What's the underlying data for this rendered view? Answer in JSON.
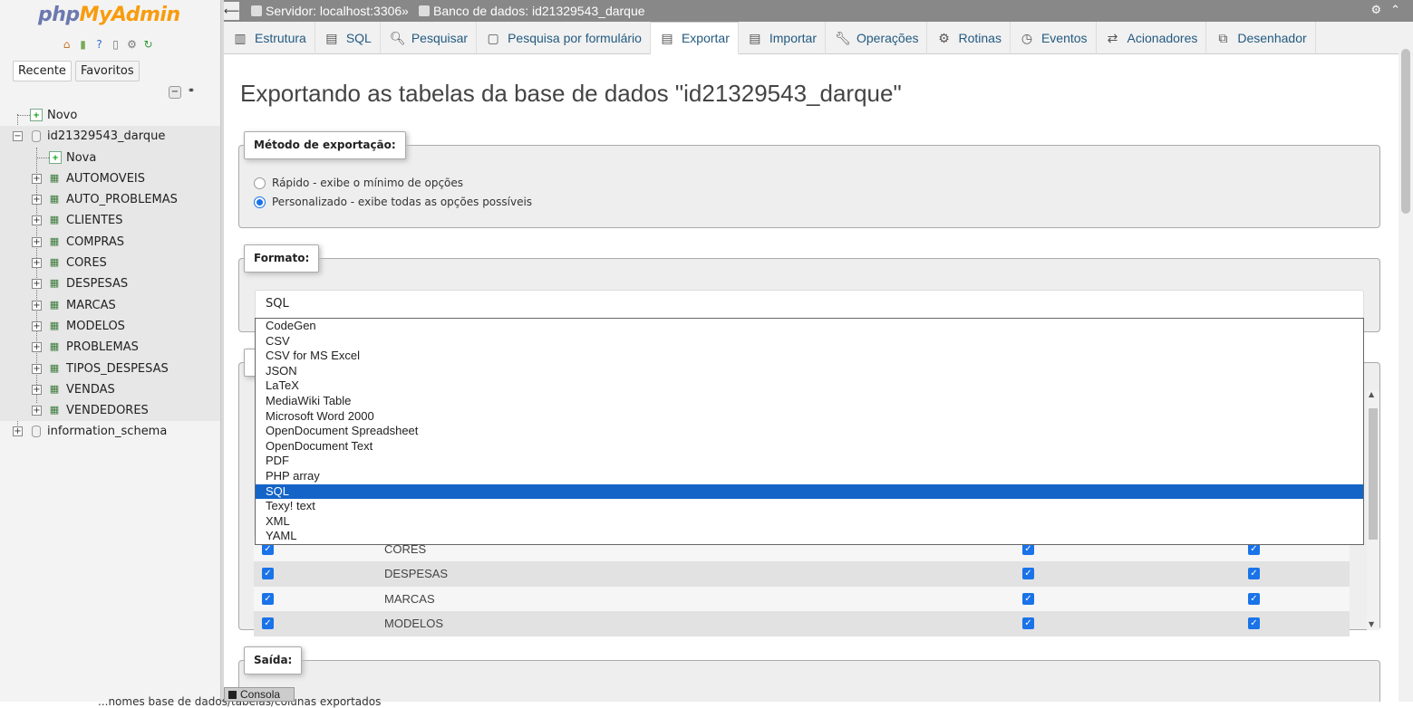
{
  "nav": {
    "logo_part1": "php",
    "logo_part2": "MyAdmin",
    "icons": [
      "home-icon",
      "exit-icon",
      "help-icon",
      "docs-icon",
      "settings-icon",
      "reload-icon"
    ],
    "tabs": [
      "Recente",
      "Favoritos"
    ],
    "tree": {
      "new_server_item": "Novo",
      "database": "id21329543_darque",
      "new_table_item": "Nova",
      "tables": [
        "AUTOMOVEIS",
        "AUTO_PROBLEMAS",
        "CLIENTES",
        "COMPRAS",
        "CORES",
        "DESPESAS",
        "MARCAS",
        "MODELOS",
        "PROBLEMAS",
        "TIPOS_DESPESAS",
        "VENDAS",
        "VENDEDORES"
      ],
      "other_database": "information_schema"
    }
  },
  "topbar": {
    "server": "Servidor: localhost:3306",
    "separator": "»",
    "database": "Banco de dados: id21329543_darque"
  },
  "tabs": [
    {
      "label": "Estrutura",
      "icon": "structure-icon"
    },
    {
      "label": "SQL",
      "icon": "sql-icon"
    },
    {
      "label": "Pesquisar",
      "icon": "search-icon"
    },
    {
      "label": "Pesquisa por formulário",
      "icon": "query-icon"
    },
    {
      "label": "Exportar",
      "icon": "export-icon",
      "active": true
    },
    {
      "label": "Importar",
      "icon": "import-icon"
    },
    {
      "label": "Operações",
      "icon": "wrench-icon"
    },
    {
      "label": "Rotinas",
      "icon": "routines-icon"
    },
    {
      "label": "Eventos",
      "icon": "events-icon"
    },
    {
      "label": "Acionadores",
      "icon": "triggers-icon"
    },
    {
      "label": "Desenhador",
      "icon": "designer-icon"
    }
  ],
  "main": {
    "title": "Exportando as tabelas da base de dados \"id21329543_darque\"",
    "export_method": {
      "legend": "Método de exportação:",
      "options": [
        {
          "label": "Rápido - exibe o mínimo de opções",
          "selected": false
        },
        {
          "label": "Personalizado - exibe todas as opções possíveis",
          "selected": true
        }
      ]
    },
    "format": {
      "legend": "Formato:",
      "selected": "SQL",
      "options": [
        "CodeGen",
        "CSV",
        "CSV for MS Excel",
        "JSON",
        "LaTeX",
        "MediaWiki Table",
        "Microsoft Word 2000",
        "OpenDocument Spreadsheet",
        "OpenDocument Text",
        "PDF",
        "PHP array",
        "SQL",
        "Texy! text",
        "XML",
        "YAML"
      ]
    },
    "tables_list": [
      {
        "name": "CORES",
        "select": true,
        "structure": true,
        "data": true
      },
      {
        "name": "DESPESAS",
        "select": true,
        "structure": true,
        "data": true
      },
      {
        "name": "MARCAS",
        "select": true,
        "structure": true,
        "data": true
      },
      {
        "name": "MODELOS",
        "select": true,
        "structure": true,
        "data": true
      }
    ],
    "output": {
      "legend": "Saída:",
      "hint": "...nomes base de dados/tabelas/colunas exportados"
    }
  },
  "console": {
    "label": "Consola"
  },
  "colors": {
    "accent": "#1a73e8",
    "selection": "#1464c8",
    "link": "#235a81",
    "topbar": "#888888"
  }
}
